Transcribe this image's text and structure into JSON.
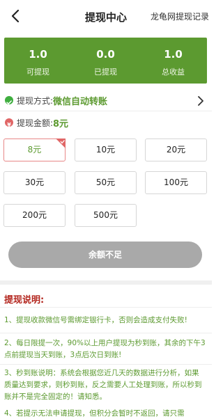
{
  "header": {
    "title": "提现中心",
    "records_link": "龙龟网提现记录"
  },
  "stats": [
    {
      "value": "1.0",
      "label": "可提现"
    },
    {
      "value": "0.0",
      "label": "已提现"
    },
    {
      "value": "1.0",
      "label": "总收益"
    }
  ],
  "method": {
    "label": "提现方式:",
    "value": "微信自动转账"
  },
  "amount": {
    "label": "提现金额:",
    "value": "8元"
  },
  "options": [
    "8元",
    "10元",
    "20元",
    "30元",
    "50元",
    "100元",
    "200元",
    "500元"
  ],
  "selected_option": "8元",
  "submit_label": "余额不足",
  "notes": {
    "title": "提现说明:",
    "items": [
      "1、提现收款微信号需绑定银行卡，否则会造成支付失败!",
      "2、每日限提一次，90%以上用户提现为秒到账，其余的下午3点前提现当天到账，3点后次日到账!",
      "3、秒到账说明：系统会根据您近几天的数据进行分析，如果质量达到要求，则秒到账，反之需要人工处理到账，所以秒到账并不是完全固定的！请知悉。",
      "4、若提示无法申请提现，但积分会暂时不返回，请只需"
    ]
  },
  "colors": {
    "accent_green": "#5c9a30",
    "note_title_red": "#b3261e",
    "disabled_button": "#a9a9a9"
  },
  "icons": {
    "back": "back-arrow-icon",
    "method": "wechat-icon",
    "amount": "yen-coin-icon",
    "chevron": "chevron-right-icon",
    "selected_corner": "checkmark-corner-icon"
  }
}
